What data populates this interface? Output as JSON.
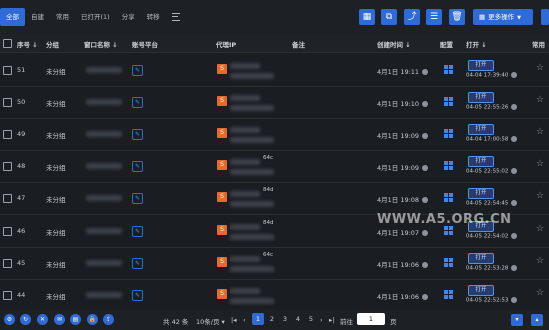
{
  "tabs": [
    {
      "label": "全部",
      "active": true
    },
    {
      "label": "自建"
    },
    {
      "label": "常用"
    },
    {
      "label": "已打开(1)"
    },
    {
      "label": "分享"
    },
    {
      "label": "转移"
    }
  ],
  "toolbar": {
    "more_label": "更多操作"
  },
  "columns": {
    "seq": "序号",
    "group": "分组",
    "window_name": "窗口名称",
    "account_platform": "账号平台",
    "proxy_ip": "代理IP",
    "note": "备注",
    "created_time": "创建时间",
    "config": "配置",
    "open": "打开",
    "common": "常用"
  },
  "rows": [
    {
      "seq": "51",
      "group": "未分组",
      "proxy_tail": "",
      "created": "4月1日 19:11",
      "open_label": "打开",
      "open_time": "04-04 17:39:40"
    },
    {
      "seq": "50",
      "group": "未分组",
      "proxy_tail": "",
      "created": "4月1日 19:10",
      "open_label": "打开",
      "open_time": "04-05 22:55:26"
    },
    {
      "seq": "49",
      "group": "未分组",
      "proxy_tail": "",
      "created": "4月1日 19:09",
      "open_label": "打开",
      "open_time": "04-04 17:00:58"
    },
    {
      "seq": "48",
      "group": "未分组",
      "proxy_tail": "64c",
      "created": "4月1日 19:09",
      "open_label": "打开",
      "open_time": "04-05 22:55:02"
    },
    {
      "seq": "47",
      "group": "未分组",
      "proxy_tail": "84d",
      "created": "4月1日 19:08",
      "open_label": "打开",
      "open_time": "04-05 22:54:45"
    },
    {
      "seq": "46",
      "group": "未分组",
      "proxy_tail": "84d",
      "created": "4月1日 19:07",
      "open_label": "打开",
      "open_time": "04-05 22:54:02"
    },
    {
      "seq": "45",
      "group": "未分组",
      "proxy_tail": "64c",
      "created": "4月1日 19:06",
      "open_label": "打开",
      "open_time": "04-05 22:53:28"
    },
    {
      "seq": "44",
      "group": "未分组",
      "proxy_tail": "",
      "created": "4月1日 19:06",
      "open_label": "打开",
      "open_time": "04-05 22:52:53"
    }
  ],
  "footer": {
    "total": "共 42 条",
    "per_page": "10条/页",
    "pages": [
      "1",
      "2",
      "3",
      "4",
      "5"
    ],
    "current_page": "1",
    "goto_label": "前往",
    "goto_value": "1",
    "page_suffix": "页"
  },
  "watermark": "WWW.A5.ORG.CN",
  "colors": {
    "accent": "#2f6bd6",
    "proxy": "#e8692b",
    "background": "#1a1d22"
  }
}
